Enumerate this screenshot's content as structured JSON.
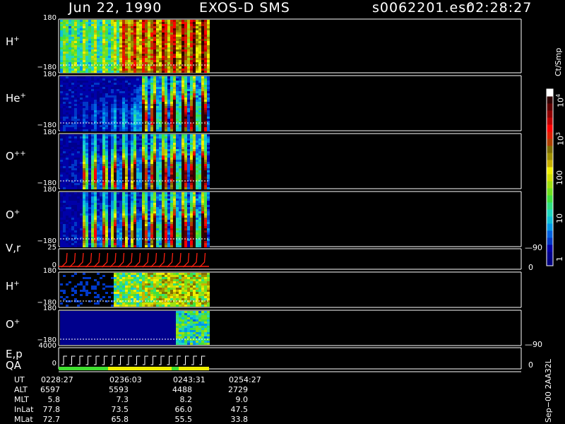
{
  "header": {
    "date": "Jun 22, 1990",
    "instrument": "EXOS-D SMS",
    "file": "s0062201.esr",
    "time": "02:28:27"
  },
  "panels": [
    {
      "id": "hplus",
      "label": "H",
      "sup": "+",
      "top": "180",
      "bottom": "−180"
    },
    {
      "id": "heplus",
      "label": "He",
      "sup": "+",
      "top": "180",
      "bottom": "−180"
    },
    {
      "id": "oplusplus",
      "label": "O",
      "sup": "++",
      "top": "180",
      "bottom": "−180"
    },
    {
      "id": "oplus",
      "label": "O",
      "sup": "+",
      "top": "180",
      "bottom": "−180"
    },
    {
      "id": "vr",
      "label": "V,r",
      "sup": "",
      "top": "25",
      "bottom": "0",
      "right_top": "90",
      "right_bottom": "0"
    },
    {
      "id": "hplus2",
      "label": "H",
      "sup": "+",
      "top": "180",
      "bottom": "−180"
    },
    {
      "id": "oplus2",
      "label": "O",
      "sup": "+",
      "top": "180",
      "bottom": "−180"
    },
    {
      "id": "ep",
      "label": "E,p",
      "sup": "",
      "top": "4000",
      "bottom": "0",
      "right_top": "90",
      "right_bottom": "0"
    }
  ],
  "qa_label": "QA",
  "colorbar": {
    "unit": "Ct/Smp",
    "labels": [
      {
        "text": "10",
        "sup": "4"
      },
      {
        "text": "10",
        "sup": "3"
      },
      {
        "text": "100",
        "sup": ""
      },
      {
        "text": "10",
        "sup": ""
      },
      {
        "text": "1",
        "sup": ""
      }
    ],
    "colors": [
      "#000080",
      "#00008c",
      "#0000a8",
      "#0038c8",
      "#0060e0",
      "#0098e8",
      "#10c0d8",
      "#20d8c0",
      "#30e080",
      "#40e040",
      "#70e020",
      "#a0e010",
      "#d0e000",
      "#f0f000",
      "#c8b000",
      "#a09000",
      "#807000",
      "#b04000",
      "#e02000",
      "#ff0000",
      "#c00000",
      "#900000",
      "#600000",
      "#300000",
      "#ffffff"
    ]
  },
  "footer": {
    "rows": [
      {
        "label": "UT",
        "values": [
          "0228:27",
          "0236:03",
          "0243:31",
          "0254:27"
        ]
      },
      {
        "label": "ALT",
        "values": [
          "6597",
          "5593",
          "4488",
          "2729"
        ]
      },
      {
        "label": "MLT",
        "values": [
          "5.8",
          "7.3",
          "8.2",
          "9.0"
        ]
      },
      {
        "label": "InLat",
        "values": [
          "77.8",
          "73.5",
          "66.0",
          "47.5"
        ]
      },
      {
        "label": "MLat",
        "values": [
          "72.7",
          "65.8",
          "55.5",
          "33.8"
        ]
      }
    ],
    "side_text": "Sep−00  2AA32L"
  },
  "chart_data": {
    "type": "heatmap",
    "title": "Jun 22, 1990   EXOS-D SMS",
    "x": {
      "labels": [
        "0228:27",
        "0236:03",
        "0243:31",
        "0254:27"
      ]
    },
    "series": [
      {
        "name": "H+",
        "ylim": [
          -180,
          180
        ]
      },
      {
        "name": "He+",
        "ylim": [
          -180,
          180
        ]
      },
      {
        "name": "O++",
        "ylim": [
          -180,
          180
        ]
      },
      {
        "name": "O+",
        "ylim": [
          -180,
          180
        ]
      },
      {
        "name": "V,r",
        "ylim": [
          0,
          25
        ]
      },
      {
        "name": "H+",
        "ylim": [
          -180,
          180
        ]
      },
      {
        "name": "O+",
        "ylim": [
          -180,
          180
        ]
      },
      {
        "name": "E,p",
        "ylim": [
          0,
          4000
        ]
      }
    ],
    "colorscale": {
      "unit": "Ct/Smp",
      "range": [
        1,
        10000
      ],
      "log": true
    },
    "grid": false
  }
}
